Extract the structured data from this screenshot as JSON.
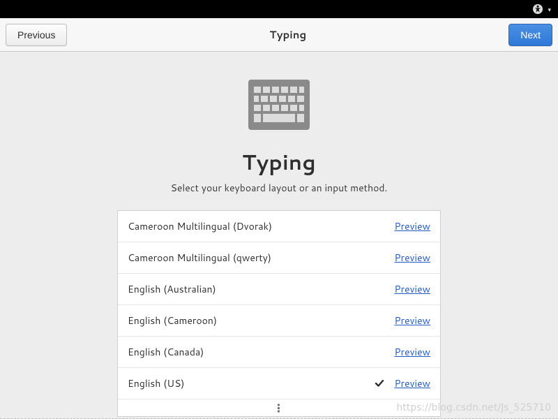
{
  "topbar": {
    "a11y_icon": "accessibility-icon",
    "chevron": "▾"
  },
  "header": {
    "previous_label": "Previous",
    "title": "Typing",
    "next_label": "Next"
  },
  "page": {
    "heading": "Typing",
    "subtitle": "Select your keyboard layout or an input method."
  },
  "layouts": [
    {
      "name": "Cameroon Multilingual (Dvorak)",
      "selected": false,
      "preview": "Preview"
    },
    {
      "name": "Cameroon Multilingual (qwerty)",
      "selected": false,
      "preview": "Preview"
    },
    {
      "name": "English (Australian)",
      "selected": false,
      "preview": "Preview"
    },
    {
      "name": "English (Cameroon)",
      "selected": false,
      "preview": "Preview"
    },
    {
      "name": "English (Canada)",
      "selected": false,
      "preview": "Preview"
    },
    {
      "name": "English (US)",
      "selected": true,
      "preview": "Preview"
    }
  ],
  "more_indicator": "⋮",
  "watermark": "https://blog.csdn.net/Js_525710"
}
